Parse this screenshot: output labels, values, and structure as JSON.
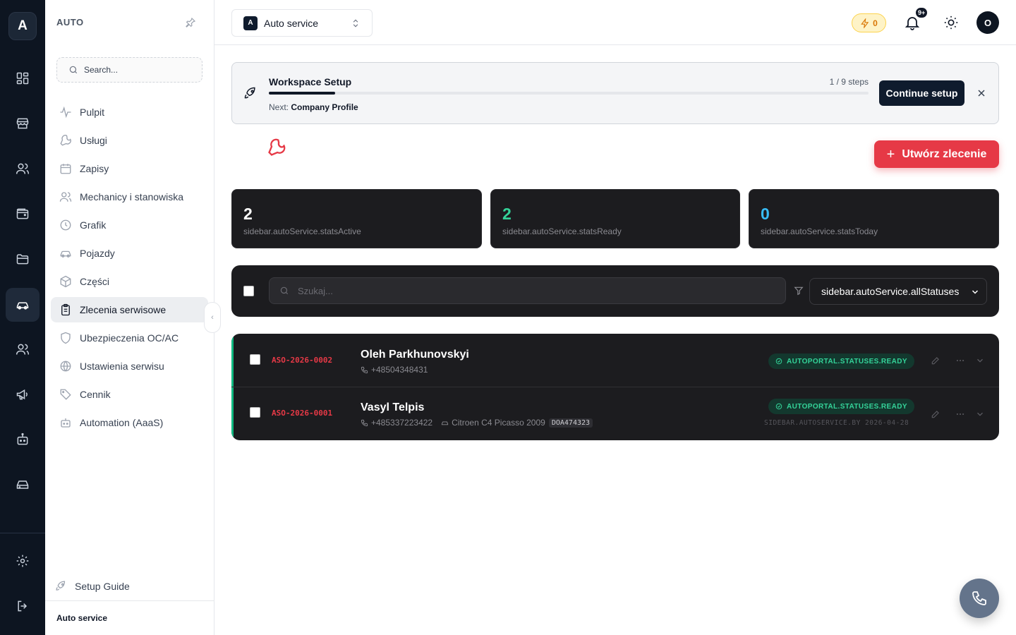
{
  "rail": {
    "logo": "A",
    "icons": [
      "dashboard-icon",
      "store-icon",
      "users-icon",
      "wallet-icon",
      "folder-icon",
      "car-icon",
      "team-icon",
      "megaphone-icon",
      "robot-icon",
      "drive-icon",
      "settings-icon",
      "logout-icon"
    ]
  },
  "sidebar": {
    "title": "AUTO",
    "search_placeholder": "Search...",
    "items": [
      {
        "label": "Pulpit",
        "icon": "activity-icon"
      },
      {
        "label": "Usługi",
        "icon": "wrench-icon"
      },
      {
        "label": "Zapisy",
        "icon": "calendar-icon"
      },
      {
        "label": "Mechanicy i stanowiska",
        "icon": "users-icon"
      },
      {
        "label": "Grafik",
        "icon": "clock-icon"
      },
      {
        "label": "Pojazdy",
        "icon": "car-icon"
      },
      {
        "label": "Części",
        "icon": "box-icon"
      },
      {
        "label": "Zlecenia serwisowe",
        "icon": "clipboard-icon"
      },
      {
        "label": "Ubezpieczenia OC/AC",
        "icon": "shield-icon"
      },
      {
        "label": "Ustawienia serwisu",
        "icon": "globe-icon"
      },
      {
        "label": "Cennik",
        "icon": "tag-icon"
      },
      {
        "label": "Automation (AaaS)",
        "icon": "robot-icon"
      }
    ],
    "active_index": 7,
    "setup_guide": "Setup Guide",
    "footer": "Auto service"
  },
  "topbar": {
    "workspace_badge": "A",
    "workspace_name": "Auto service",
    "credits": "0",
    "notifications": "9+",
    "avatar": "O"
  },
  "setup": {
    "title": "Workspace Setup",
    "steps": "1 / 9 steps",
    "progress": 0.111,
    "next_label": "Next:",
    "next_value": "Company Profile",
    "continue_label": "Continue setup"
  },
  "page": {
    "create_label": "Utwórz zlecenie"
  },
  "stats": [
    {
      "value": "2",
      "label": "sidebar.autoService.statsActive",
      "color": "#ffffff"
    },
    {
      "value": "2",
      "label": "sidebar.autoService.statsReady",
      "color": "#34d399"
    },
    {
      "value": "0",
      "label": "sidebar.autoService.statsToday",
      "color": "#38bdf8"
    }
  ],
  "filters": {
    "search_placeholder": "Szukaj...",
    "status_value": "sidebar.autoService.allStatuses"
  },
  "orders": [
    {
      "id": "ASO-2026-0002",
      "name": "Oleh Parkhunovskyi",
      "phone": "+48504348431",
      "car": "",
      "plate": "",
      "status": "AUTOPORTAL.STATUSES.READY",
      "by": ""
    },
    {
      "id": "ASO-2026-0001",
      "name": "Vasyl Telpis",
      "phone": "+485337223422",
      "car": "Citroen C4 Picasso 2009",
      "plate": "DOA474323",
      "status": "AUTOPORTAL.STATUSES.READY",
      "by": "SIDEBAR.AUTOSERVICE.BY 2026-04-28"
    }
  ],
  "colors": {
    "accent_red": "#e63946",
    "ready_green": "#34d399",
    "navy": "#0f1b2d"
  }
}
